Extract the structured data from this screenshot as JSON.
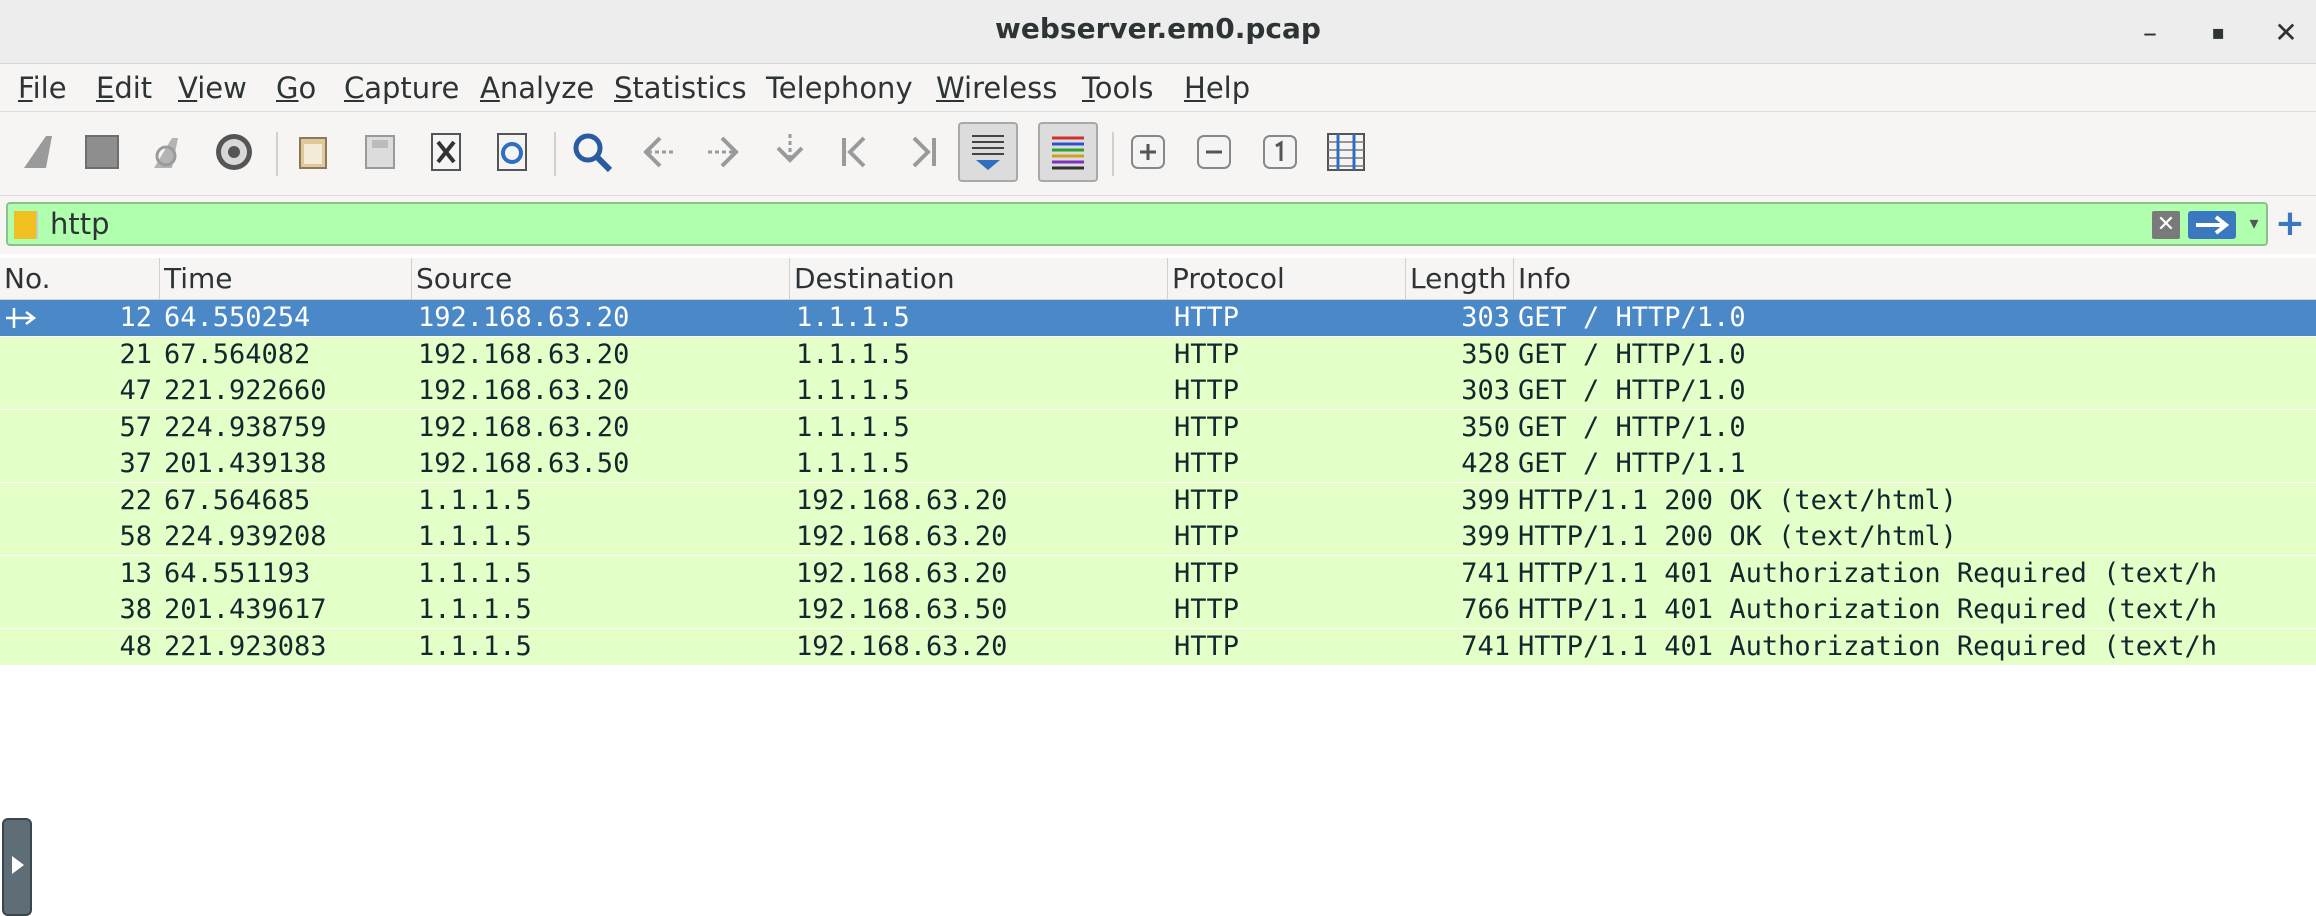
{
  "window": {
    "title": "webserver.em0.pcap",
    "controls": {
      "minimize": "–",
      "maximize": "▪",
      "close": "✕"
    }
  },
  "menu": [
    {
      "label": "File",
      "mnemonic": "F",
      "rest": "ile"
    },
    {
      "label": "Edit",
      "mnemonic": "E",
      "rest": "dit"
    },
    {
      "label": "View",
      "mnemonic": "V",
      "rest": "iew"
    },
    {
      "label": "Go",
      "mnemonic": "G",
      "rest": "o"
    },
    {
      "label": "Capture",
      "mnemonic": "C",
      "rest": "apture"
    },
    {
      "label": "Analyze",
      "mnemonic": "A",
      "rest": "nalyze"
    },
    {
      "label": "Statistics",
      "mnemonic": "S",
      "rest": "tatistics"
    },
    {
      "label": "Telephony",
      "mnemonic": "",
      "rest": "Telephony"
    },
    {
      "label": "Wireless",
      "mnemonic": "W",
      "rest": "ireless"
    },
    {
      "label": "Tools",
      "mnemonic": "T",
      "rest": "ools"
    },
    {
      "label": "Help",
      "mnemonic": "H",
      "rest": "elp"
    }
  ],
  "toolbar": {
    "icons": [
      "start-capture-icon",
      "stop-capture-icon",
      "restart-capture-icon",
      "capture-options-icon",
      "open-file-icon",
      "save-file-icon",
      "close-file-icon",
      "reload-file-icon",
      "find-packet-icon",
      "go-back-icon",
      "go-forward-icon",
      "go-to-packet-icon",
      "first-packet-icon",
      "last-packet-icon",
      "autoscroll-icon",
      "colorize-icon",
      "zoom-in-icon",
      "zoom-out-icon",
      "normal-size-icon",
      "resize-columns-icon"
    ]
  },
  "filter": {
    "value": "http",
    "clear_symbol": "✕",
    "dropdown_symbol": "▾",
    "add_symbol": "+"
  },
  "colors": {
    "row_bg": "#e4ffc7",
    "selected_bg": "#4a88c7",
    "filter_bg": "#afffaf"
  },
  "packet_list": {
    "columns": [
      "No.",
      "Time",
      "Source",
      "Destination",
      "Protocol",
      "Length",
      "Info"
    ],
    "rows": [
      {
        "no": "12",
        "time": "64.550254",
        "source": "192.168.63.20",
        "destination": "1.1.1.5",
        "protocol": "HTTP",
        "length": "303",
        "info": "GET / HTTP/1.0",
        "selected": true
      },
      {
        "no": "21",
        "time": "67.564082",
        "source": "192.168.63.20",
        "destination": "1.1.1.5",
        "protocol": "HTTP",
        "length": "350",
        "info": "GET / HTTP/1.0"
      },
      {
        "no": "47",
        "time": "221.922660",
        "source": "192.168.63.20",
        "destination": "1.1.1.5",
        "protocol": "HTTP",
        "length": "303",
        "info": "GET / HTTP/1.0"
      },
      {
        "no": "57",
        "time": "224.938759",
        "source": "192.168.63.20",
        "destination": "1.1.1.5",
        "protocol": "HTTP",
        "length": "350",
        "info": "GET / HTTP/1.0"
      },
      {
        "no": "37",
        "time": "201.439138",
        "source": "192.168.63.50",
        "destination": "1.1.1.5",
        "protocol": "HTTP",
        "length": "428",
        "info": "GET / HTTP/1.1"
      },
      {
        "no": "22",
        "time": "67.564685",
        "source": "1.1.1.5",
        "destination": "192.168.63.20",
        "protocol": "HTTP",
        "length": "399",
        "info": "HTTP/1.1 200 OK  (text/html)"
      },
      {
        "no": "58",
        "time": "224.939208",
        "source": "1.1.1.5",
        "destination": "192.168.63.20",
        "protocol": "HTTP",
        "length": "399",
        "info": "HTTP/1.1 200 OK  (text/html)"
      },
      {
        "no": "13",
        "time": "64.551193",
        "source": "1.1.1.5",
        "destination": "192.168.63.20",
        "protocol": "HTTP",
        "length": "741",
        "info": "HTTP/1.1 401 Authorization Required  (text/h"
      },
      {
        "no": "38",
        "time": "201.439617",
        "source": "1.1.1.5",
        "destination": "192.168.63.50",
        "protocol": "HTTP",
        "length": "766",
        "info": "HTTP/1.1 401 Authorization Required  (text/h"
      },
      {
        "no": "48",
        "time": "221.923083",
        "source": "1.1.1.5",
        "destination": "192.168.63.20",
        "protocol": "HTTP",
        "length": "741",
        "info": "HTTP/1.1 401 Authorization Required  (text/h"
      }
    ]
  }
}
